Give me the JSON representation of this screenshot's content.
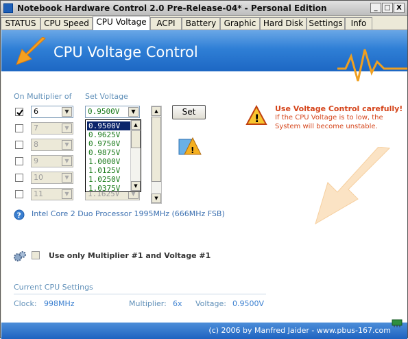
{
  "window": {
    "title": "Notebook Hardware Control 2.0 Pre-Release-04* - Personal Edition",
    "controls": [
      "_",
      "□",
      "X"
    ]
  },
  "tabs": [
    {
      "label": "STATUS"
    },
    {
      "label": "CPU Speed"
    },
    {
      "label": "CPU Voltage",
      "active": true
    },
    {
      "label": "ACPI"
    },
    {
      "label": "Battery"
    },
    {
      "label": "Graphic"
    },
    {
      "label": "Hard Disk"
    },
    {
      "label": "Settings"
    },
    {
      "label": "Info"
    }
  ],
  "header": {
    "title": "CPU Voltage Control"
  },
  "columns": {
    "multiplier": "On Multiplier of",
    "voltage": "Set Voltage"
  },
  "rows": [
    {
      "multiplier": "6",
      "checked": true,
      "enabled": true
    },
    {
      "multiplier": "7",
      "checked": false,
      "enabled": false
    },
    {
      "multiplier": "8",
      "checked": false,
      "enabled": false
    },
    {
      "multiplier": "9",
      "checked": false,
      "enabled": false
    },
    {
      "multiplier": "10",
      "checked": false,
      "enabled": false
    },
    {
      "multiplier": "11",
      "checked": false,
      "enabled": false
    }
  ],
  "voltage_select": {
    "value": "0.9500V",
    "last_visible_value": "1.1625V",
    "options": [
      "0.9500V",
      "0.9625V",
      "0.9750V",
      "0.9875V",
      "1.0000V",
      "1.0125V",
      "1.0250V",
      "1.0375V"
    ],
    "selected_index": 0
  },
  "set_button": "Set",
  "warning": {
    "title": "Use Voltage Control carefully!",
    "line1": "If the CPU Voltage is to low, the",
    "line2": "System will become unstable."
  },
  "processor_info": "Intel Core 2 Duo Processor 1995MHz (666MHz FSB)",
  "option_label": "Use only Multiplier #1 and Voltage #1",
  "current": {
    "heading": "Current CPU Settings",
    "clock_label": "Clock:",
    "clock_value": "998MHz",
    "multiplier_label": "Multiplier:",
    "multiplier_value": "6x",
    "voltage_label": "Voltage:",
    "voltage_value": "0.9500V"
  },
  "footer": "(c) 2006 by Manfred Jaider  -  www.pbus-167.com",
  "colors": {
    "accent_blue": "#2f7fd6",
    "warning_orange": "#d5441a",
    "voltage_green": "#1a7a1a"
  }
}
